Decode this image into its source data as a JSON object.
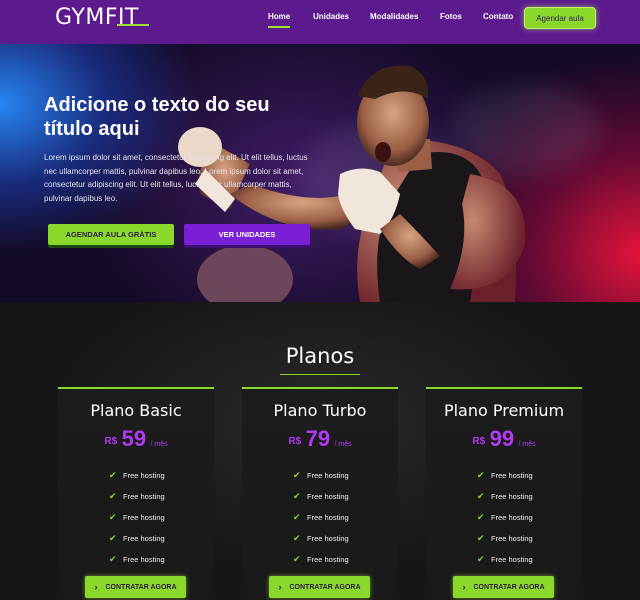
{
  "brand": {
    "logo": "GYMFIT",
    "logo_main": "GYM",
    "logo_accent": "FIT"
  },
  "nav": {
    "items": [
      {
        "label": "Home",
        "active": true
      },
      {
        "label": "Unidades",
        "active": false
      },
      {
        "label": "Modalidades",
        "active": false
      },
      {
        "label": "Fotos",
        "active": false
      },
      {
        "label": "Contato",
        "active": false
      }
    ],
    "cta_label": "Agendar aula"
  },
  "hero": {
    "title": "Adicione o texto do seu título aqui",
    "text": "Lorem ipsum dolor sit amet, consectetur adipiscing elit. Ut elit tellus, luctus nec ullamcorper mattis, pulvinar dapibus leo. Lorem ipsum dolor sit amet, consectetur adipiscing elit. Ut elit tellus, luctus nec ullamcorper mattis, pulvinar dapibus leo.",
    "btn_primary": "AGENDAR AULA GRÁTIS",
    "btn_secondary": "VER UNIDADES"
  },
  "plans": {
    "title": "Planos",
    "items": [
      {
        "name": "Plano Basic",
        "currency": "R$",
        "price": "59",
        "period": "/ mês",
        "features": [
          "Free hosting",
          "Free hosting",
          "Free hosting",
          "Free hosting",
          "Free hosting"
        ],
        "button": "CONTRATAR AGORA"
      },
      {
        "name": "Plano Turbo",
        "currency": "R$",
        "price": "79",
        "period": "/ mês",
        "features": [
          "Free hosting",
          "Free hosting",
          "Free hosting",
          "Free hosting",
          "Free hosting"
        ],
        "button": "CONTRATAR AGORA"
      },
      {
        "name": "Plano Premium",
        "currency": "R$",
        "price": "99",
        "period": "/ mês",
        "features": [
          "Free hosting",
          "Free hosting",
          "Free hosting",
          "Free hosting",
          "Free hosting"
        ],
        "button": "CONTRATAR AGORA"
      }
    ]
  },
  "colors": {
    "nav_bg": "#5d1a8f",
    "accent_green": "#8ad82b",
    "accent_purple": "#b138f5",
    "dark_bg": "#141414"
  },
  "icons": {
    "feature": "check-icon",
    "button": "chevron-right-icon"
  }
}
